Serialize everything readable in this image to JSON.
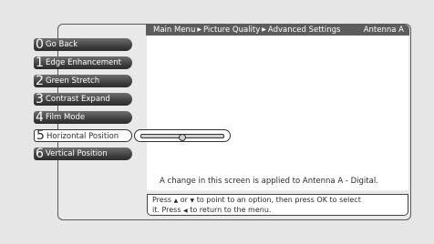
{
  "header": {
    "crumbs": [
      "Main Menu",
      "Picture Quality",
      "Advanced Settings"
    ],
    "antenna": "Antenna A"
  },
  "menu": {
    "items": [
      {
        "num": "0",
        "label": "Go Back"
      },
      {
        "num": "1",
        "label": "Edge Enhancement"
      },
      {
        "num": "2",
        "label": "Green Stretch"
      },
      {
        "num": "3",
        "label": "Contrast Expand"
      },
      {
        "num": "4",
        "label": "Film Mode"
      },
      {
        "num": "5",
        "label": "Horizontal Position"
      },
      {
        "num": "6",
        "label": "Vertical Position"
      }
    ],
    "selected_index": 5
  },
  "slider": {
    "value_fraction": 0.5
  },
  "content": {
    "note": "A change in this screen is applied to Antenna A - Digital."
  },
  "help": {
    "line1_a": "Press",
    "line1_b": "or",
    "line1_c": "to point to an option, then press OK to select",
    "line2_a": "it. Press",
    "line2_b": "to return to the menu."
  },
  "colors": {
    "header_bg": "#5c5c5c",
    "button_dark": "#3a3a3a",
    "screen_bg": "#e6e6e6"
  }
}
